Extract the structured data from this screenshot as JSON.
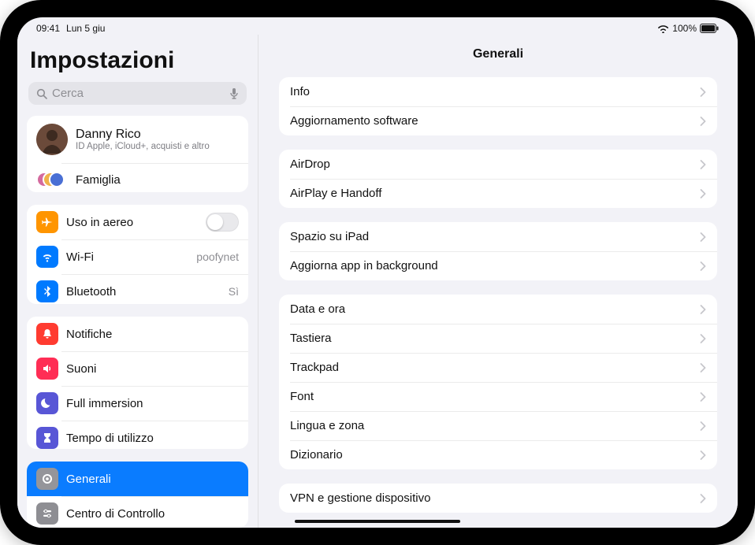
{
  "status": {
    "time": "09:41",
    "date": "Lun 5 giu",
    "battery": "100%"
  },
  "sidebar": {
    "title": "Impostazioni",
    "search_placeholder": "Cerca",
    "account": {
      "name": "Danny Rico",
      "subtitle": "ID Apple, iCloud+, acquisti e altro"
    },
    "family_label": "Famiglia",
    "items": {
      "airplane": {
        "label": "Uso in aereo",
        "color": "#ff9500"
      },
      "wifi": {
        "label": "Wi-Fi",
        "value": "poofynet",
        "color": "#007aff"
      },
      "bluetooth": {
        "label": "Bluetooth",
        "value": "Sì",
        "color": "#007aff"
      },
      "notifications": {
        "label": "Notifiche",
        "color": "#ff3b30"
      },
      "sounds": {
        "label": "Suoni",
        "color": "#ff3b30"
      },
      "focus": {
        "label": "Full immersion",
        "color": "#5856d6"
      },
      "screentime": {
        "label": "Tempo di utilizzo",
        "color": "#5856d6"
      },
      "general": {
        "label": "Generali",
        "color": "#8e8e93"
      },
      "controlcenter": {
        "label": "Centro di Controllo",
        "color": "#8e8e93"
      }
    }
  },
  "detail": {
    "title": "Generali",
    "groups": [
      {
        "rows": [
          "Info",
          "Aggiornamento software"
        ]
      },
      {
        "rows": [
          "AirDrop",
          "AirPlay e Handoff"
        ]
      },
      {
        "rows": [
          "Spazio su iPad",
          "Aggiorna app in background"
        ]
      },
      {
        "rows": [
          "Data e ora",
          "Tastiera",
          "Trackpad",
          "Font",
          "Lingua e zona",
          "Dizionario"
        ]
      },
      {
        "rows": [
          "VPN e gestione dispositivo"
        ]
      }
    ]
  }
}
